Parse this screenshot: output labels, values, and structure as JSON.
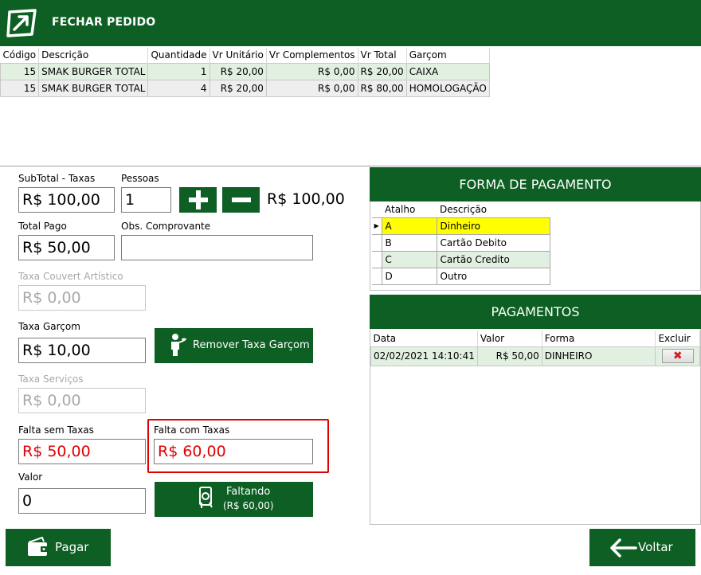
{
  "window": {
    "title": "FECHAR PEDIDO"
  },
  "orders": {
    "columns": [
      "Código",
      "Descrição",
      "Quantidade",
      "Vr Unitário",
      "Vr Complementos",
      "Vr Total",
      "Garçom"
    ],
    "rows": [
      [
        "15",
        "SMAK BURGER TOTAL",
        "1",
        "R$ 20,00",
        "R$ 0,00",
        "R$ 20,00",
        "CAIXA"
      ],
      [
        "15",
        "SMAK BURGER TOTAL",
        "4",
        "R$ 20,00",
        "R$ 0,00",
        "R$ 80,00",
        "HOMOLOGAÇÃO"
      ]
    ]
  },
  "form": {
    "subtotal_label": "SubTotal - Taxas",
    "subtotal_value": "R$ 100,00",
    "pessoas_label": "Pessoas",
    "pessoas_value": "1",
    "plus_label": "+",
    "minus_label": "−",
    "per_person_value": "R$ 100,00",
    "total_pago_label": "Total Pago",
    "total_pago_value": "R$ 50,00",
    "obs_label": "Obs. Comprovante",
    "obs_value": "",
    "couvert_label": "Taxa Couvert Artístico",
    "couvert_value": "R$ 0,00",
    "garcom_label": "Taxa Garçom",
    "garcom_value": "R$ 10,00",
    "remover_label": "Remover Taxa Garçom",
    "servicos_label": "Taxa Serviços",
    "servicos_value": "R$ 0,00",
    "falta_sem_label": "Falta sem Taxas",
    "falta_sem_value": "R$ 50,00",
    "falta_com_label": "Falta com Taxas",
    "falta_com_value": "R$ 60,00",
    "valor_label": "Valor",
    "valor_value": "0",
    "faltando_label": "Faltando",
    "faltando_value": "(R$ 60,00)"
  },
  "forma_pagamento": {
    "title": "FORMA DE PAGAMENTO",
    "columns": [
      "Atalho",
      "Descrição"
    ],
    "rows": [
      [
        "A",
        "Dinheiro"
      ],
      [
        "B",
        "Cartão Debito"
      ],
      [
        "C",
        "Cartão Credito"
      ],
      [
        "D",
        "Outro"
      ]
    ],
    "selected_index": 0
  },
  "pagamentos": {
    "title": "PAGAMENTOS",
    "columns": [
      "Data",
      "Valor",
      "Forma",
      "Excluir"
    ],
    "rows": [
      [
        "02/02/2021 14:10:41",
        "R$ 50,00",
        "DINHEIRO"
      ]
    ]
  },
  "footer": {
    "pagar_label": "Pagar",
    "voltar_label": "Voltar"
  },
  "colors": {
    "brand_green": "#0d5f23",
    "alert_red": "#e00000",
    "row_green": "#e2f0e2",
    "selected_yellow": "#ffff00"
  }
}
